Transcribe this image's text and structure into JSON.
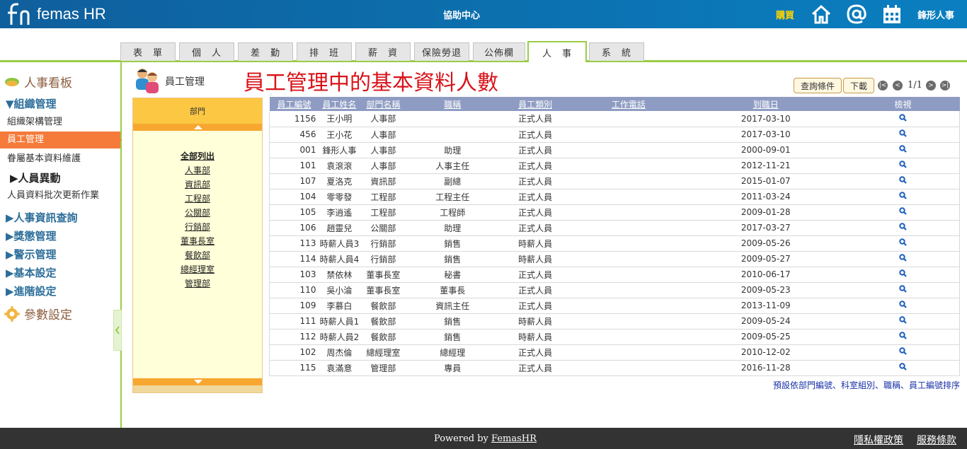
{
  "topbar": {
    "logo_text": "femas HR",
    "help_center": "協助中心",
    "buy_label": "購買",
    "home_icon": "home-icon",
    "email_icon": "at-icon",
    "calendar_icon": "calendar-icon",
    "user_name": "鋒形人事"
  },
  "tabs": [
    {
      "label": "表　單",
      "active": false
    },
    {
      "label": "個　人",
      "active": false
    },
    {
      "label": "差　勤",
      "active": false
    },
    {
      "label": "排　班",
      "active": false
    },
    {
      "label": "薪　資",
      "active": false
    },
    {
      "label": "保險勞退",
      "active": false
    },
    {
      "label": "公佈欄",
      "active": false
    },
    {
      "label": "人　事",
      "active": true
    },
    {
      "label": "系　統",
      "active": false
    }
  ],
  "sidebar": {
    "head_board": "人事看板",
    "group_org": "▼組織管理",
    "item_org_structure": "組織架構管理",
    "item_employee_mgmt": "員工管理",
    "item_dependents": "眷屬基本資料維護",
    "sub_personnel_change": "▶人員異動",
    "item_batch_update": "人員資料批次更新作業",
    "group_hr_query": "▶人事資訊查詢",
    "group_rewards": "▶獎懲管理",
    "group_warning": "▶警示管理",
    "group_basic": "▶基本設定",
    "group_advanced": "▶進階設定",
    "head_params": "參數設定"
  },
  "main": {
    "page_title": "員工管理",
    "big_title": "員工管理中的基本資料人數",
    "query_button": "查詢條件",
    "download_button": "下載",
    "pager_text": "1/1",
    "sort_note": "預設依部門編號、科室組別、職稱、員工編號排序"
  },
  "dept_panel": {
    "header": "部門",
    "links": [
      "全部列出",
      "人事部",
      "資訊部",
      "工程部",
      "公關部",
      "行銷部",
      "董事長室",
      "餐飲部",
      "總經理室",
      "管理部"
    ]
  },
  "table": {
    "columns": [
      "員工編號",
      "員工姓名",
      "部門名稱",
      "職稱",
      "員工類別",
      "工作電話",
      "到職日",
      "檢視"
    ],
    "rows": [
      [
        "1156",
        "王小明",
        "人事部",
        "",
        "正式人員",
        "",
        "2017-03-10"
      ],
      [
        "456",
        "王小花",
        "人事部",
        "",
        "正式人員",
        "",
        "2017-03-10"
      ],
      [
        "001",
        "鋒形人事",
        "人事部",
        "助理",
        "正式人員",
        "",
        "2000-09-01"
      ],
      [
        "101",
        "袁滾滾",
        "人事部",
        "人事主任",
        "正式人員",
        "",
        "2012-11-21"
      ],
      [
        "107",
        "夏洛克",
        "資訊部",
        "副總",
        "正式人員",
        "",
        "2015-01-07"
      ],
      [
        "104",
        "零零發",
        "工程部",
        "工程主任",
        "正式人員",
        "",
        "2011-03-24"
      ],
      [
        "105",
        "李逍遙",
        "工程部",
        "工程師",
        "正式人員",
        "",
        "2009-01-28"
      ],
      [
        "106",
        "趙靈兒",
        "公關部",
        "助理",
        "正式人員",
        "",
        "2017-03-27"
      ],
      [
        "113",
        "時薪人員3",
        "行銷部",
        "銷售",
        "時薪人員",
        "",
        "2009-05-26"
      ],
      [
        "114",
        "時薪人員4",
        "行銷部",
        "銷售",
        "時薪人員",
        "",
        "2009-05-27"
      ],
      [
        "103",
        "禁依林",
        "董事長室",
        "秘書",
        "正式人員",
        "",
        "2010-06-17"
      ],
      [
        "110",
        "吳小淪",
        "董事長室",
        "董事長",
        "正式人員",
        "",
        "2009-05-23"
      ],
      [
        "109",
        "李慕白",
        "餐飲部",
        "資訊主任",
        "正式人員",
        "",
        "2013-11-09"
      ],
      [
        "111",
        "時薪人員1",
        "餐飲部",
        "銷售",
        "時薪人員",
        "",
        "2009-05-24"
      ],
      [
        "112",
        "時薪人員2",
        "餐飲部",
        "銷售",
        "時薪人員",
        "",
        "2009-05-25"
      ],
      [
        "102",
        "周杰倫",
        "總經理室",
        "總經理",
        "正式人員",
        "",
        "2010-12-02"
      ],
      [
        "115",
        "袁滿意",
        "管理部",
        "專員",
        "正式人員",
        "",
        "2016-11-28"
      ]
    ]
  },
  "footer": {
    "powered_by": "Powered by ",
    "powered_link": "FemasHR",
    "privacy": "隱私權政策",
    "terms": "服務條款"
  },
  "colors": {
    "topbar": "#0a7fc0",
    "accent_green": "#9acd47",
    "active_sidebar": "#f47b3a",
    "title_red": "#d8131a",
    "table_header": "#8e9cc3"
  }
}
